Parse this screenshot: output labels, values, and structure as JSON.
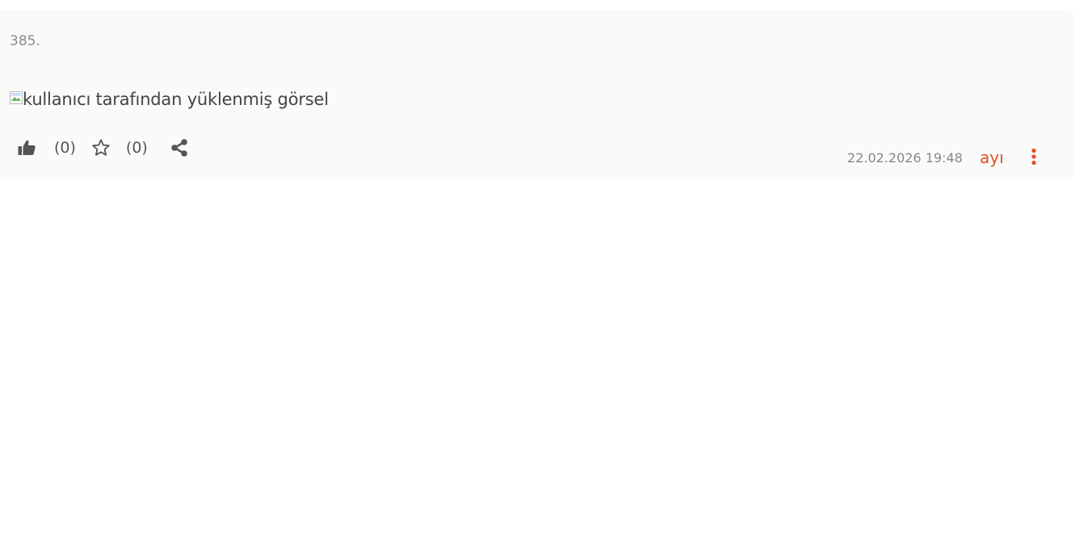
{
  "entry": {
    "number": "385.",
    "image": {
      "alt": "kullanıcı tarafından yüklenmiş görsel",
      "icon": "broken-image-icon"
    },
    "footer": {
      "like_icon": "thumbs-up-icon",
      "like_count": "(0)",
      "favorite_icon": "star-icon",
      "favorite_count": "(0)",
      "share_icon": "share-icon",
      "date": "22.02.2026 19:48",
      "author": "ayı",
      "more_icon": "ellipsis-vertical-icon"
    },
    "colors": {
      "card_background": "#fafafa",
      "author": "#e8501c",
      "icon": "#555555",
      "muted_text": "#888888"
    }
  }
}
